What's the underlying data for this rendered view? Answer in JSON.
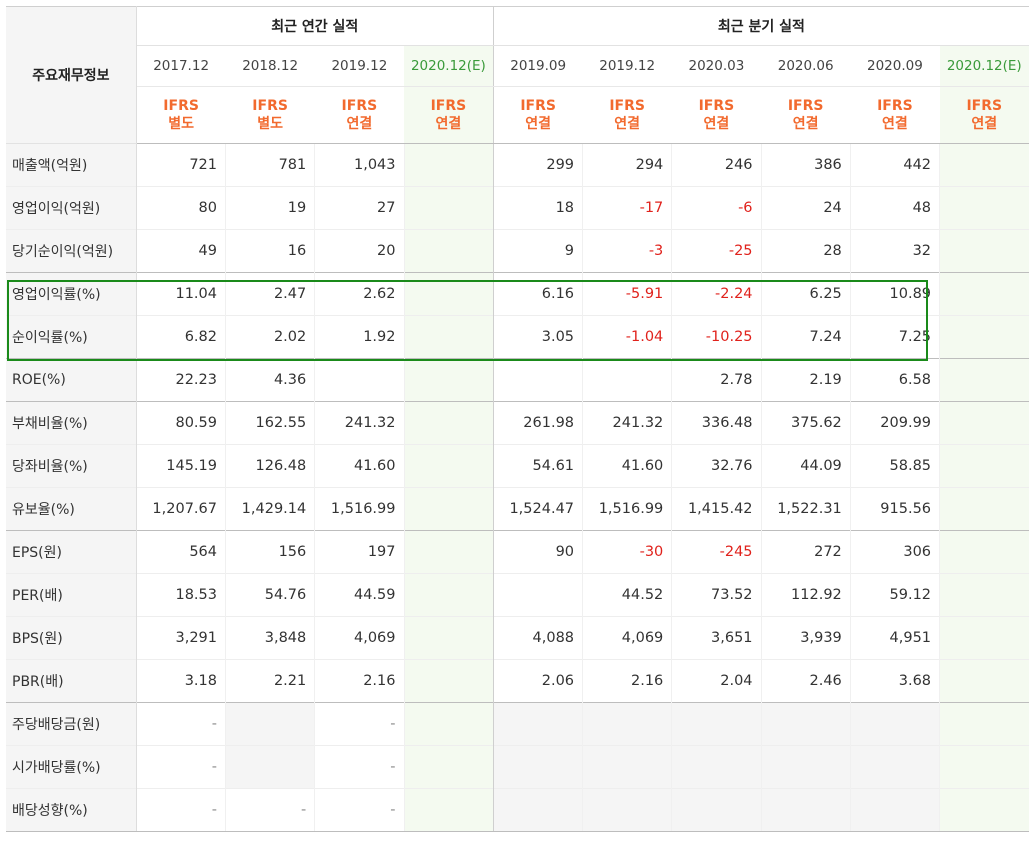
{
  "header": {
    "corner": "주요재무정보",
    "annual_group": "최근 연간 실적",
    "quarter_group": "최근 분기 실적",
    "periods": [
      "2017.12",
      "2018.12",
      "2019.12",
      "2020.12(E)",
      "2019.09",
      "2019.12",
      "2020.03",
      "2020.06",
      "2020.09",
      "2020.12(E)"
    ],
    "ifrs_top": [
      "IFRS",
      "IFRS",
      "IFRS",
      "IFRS",
      "IFRS",
      "IFRS",
      "IFRS",
      "IFRS",
      "IFRS",
      "IFRS"
    ],
    "ifrs_bottom": [
      "별도",
      "별도",
      "연결",
      "연결",
      "연결",
      "연결",
      "연결",
      "연결",
      "연결",
      "연결"
    ]
  },
  "rows": [
    {
      "label": "매출액(억원)",
      "values": [
        "721",
        "781",
        "1,043",
        "",
        "299",
        "294",
        "246",
        "386",
        "442",
        ""
      ]
    },
    {
      "label": "영업이익(억원)",
      "values": [
        "80",
        "19",
        "27",
        "",
        "18",
        "-17",
        "-6",
        "24",
        "48",
        ""
      ]
    },
    {
      "label": "당기순이익(억원)",
      "values": [
        "49",
        "16",
        "20",
        "",
        "9",
        "-3",
        "-25",
        "28",
        "32",
        ""
      ]
    },
    {
      "label": "영업이익률(%)",
      "values": [
        "11.04",
        "2.47",
        "2.62",
        "",
        "6.16",
        "-5.91",
        "-2.24",
        "6.25",
        "10.89",
        ""
      ]
    },
    {
      "label": "순이익률(%)",
      "values": [
        "6.82",
        "2.02",
        "1.92",
        "",
        "3.05",
        "-1.04",
        "-10.25",
        "7.24",
        "7.25",
        ""
      ]
    },
    {
      "label": "ROE(%)",
      "values": [
        "22.23",
        "4.36",
        "",
        "",
        "",
        "",
        "2.78",
        "2.19",
        "6.58",
        ""
      ]
    },
    {
      "label": "부채비율(%)",
      "values": [
        "80.59",
        "162.55",
        "241.32",
        "",
        "261.98",
        "241.32",
        "336.48",
        "375.62",
        "209.99",
        ""
      ]
    },
    {
      "label": "당좌비율(%)",
      "values": [
        "145.19",
        "126.48",
        "41.60",
        "",
        "54.61",
        "41.60",
        "32.76",
        "44.09",
        "58.85",
        ""
      ]
    },
    {
      "label": "유보율(%)",
      "values": [
        "1,207.67",
        "1,429.14",
        "1,516.99",
        "",
        "1,524.47",
        "1,516.99",
        "1,415.42",
        "1,522.31",
        "915.56",
        ""
      ]
    },
    {
      "label": "EPS(원)",
      "values": [
        "564",
        "156",
        "197",
        "",
        "90",
        "-30",
        "-245",
        "272",
        "306",
        ""
      ]
    },
    {
      "label": "PER(배)",
      "values": [
        "18.53",
        "54.76",
        "44.59",
        "",
        "",
        "44.52",
        "73.52",
        "112.92",
        "59.12",
        ""
      ]
    },
    {
      "label": "BPS(원)",
      "values": [
        "3,291",
        "3,848",
        "4,069",
        "",
        "4,088",
        "4,069",
        "3,651",
        "3,939",
        "4,951",
        ""
      ]
    },
    {
      "label": "PBR(배)",
      "values": [
        "3.18",
        "2.21",
        "2.16",
        "",
        "2.06",
        "2.16",
        "2.04",
        "2.46",
        "3.68",
        ""
      ]
    },
    {
      "label": "주당배당금(원)",
      "values": [
        "-",
        "",
        "-",
        "",
        "",
        "",
        "",
        "",
        "",
        ""
      ]
    },
    {
      "label": "시가배당률(%)",
      "values": [
        "-",
        "",
        "-",
        "",
        "",
        "",
        "",
        "",
        "",
        ""
      ]
    },
    {
      "label": "배당성향(%)",
      "values": [
        "-",
        "-",
        "-",
        "",
        "",
        "",
        "",
        "",
        "",
        ""
      ]
    }
  ],
  "colors": {
    "ifrs": "#f26a2e",
    "negative": "#e0221c",
    "estimate": "#3a9a3a",
    "highlight": "#1a8a1a"
  }
}
